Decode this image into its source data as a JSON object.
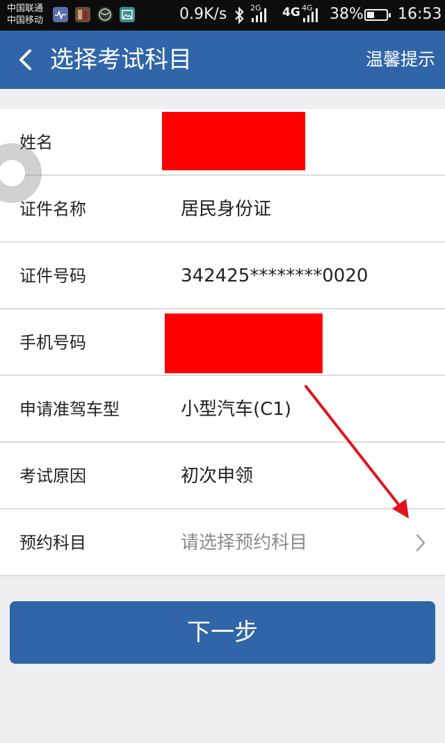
{
  "status_bar": {
    "carrier_1": "中国联通",
    "carrier_2": "中国移动",
    "net_speed": "0.9K/s",
    "net_2g": "2G",
    "net_4g_a": "4G",
    "net_4g_b": "4G",
    "battery": "38%",
    "battery_level": 0.38,
    "time": "16:53",
    "icons": [
      "health-app-icon",
      "photo-app-icon",
      "ball-app-icon",
      "gallery-app-icon",
      "bluetooth-icon",
      "signal-icon",
      "battery-icon"
    ]
  },
  "header": {
    "back_icon": "chevron-left-icon",
    "title": "选择考试科目",
    "tips": "温馨提示"
  },
  "form": {
    "name_label": "姓名",
    "id_type_label": "证件名称",
    "id_type_value": "居民身份证",
    "id_number_label": "证件号码",
    "id_number_value": "342425********0020",
    "phone_label": "手机号码",
    "vehicle_label": "申请准驾车型",
    "vehicle_value": "小型汽车(C1)",
    "reason_label": "考试原因",
    "reason_value": "初次申领",
    "subject_label": "预约科目",
    "subject_placeholder": "请选择预约科目",
    "subject_icon": "chevron-right-icon"
  },
  "actions": {
    "next_label": "下一步"
  },
  "colors": {
    "header_bg": "#3066a8",
    "button_bg": "#3066a8",
    "redaction": "#ff0000",
    "annotation_arrow": "#e0141e"
  }
}
